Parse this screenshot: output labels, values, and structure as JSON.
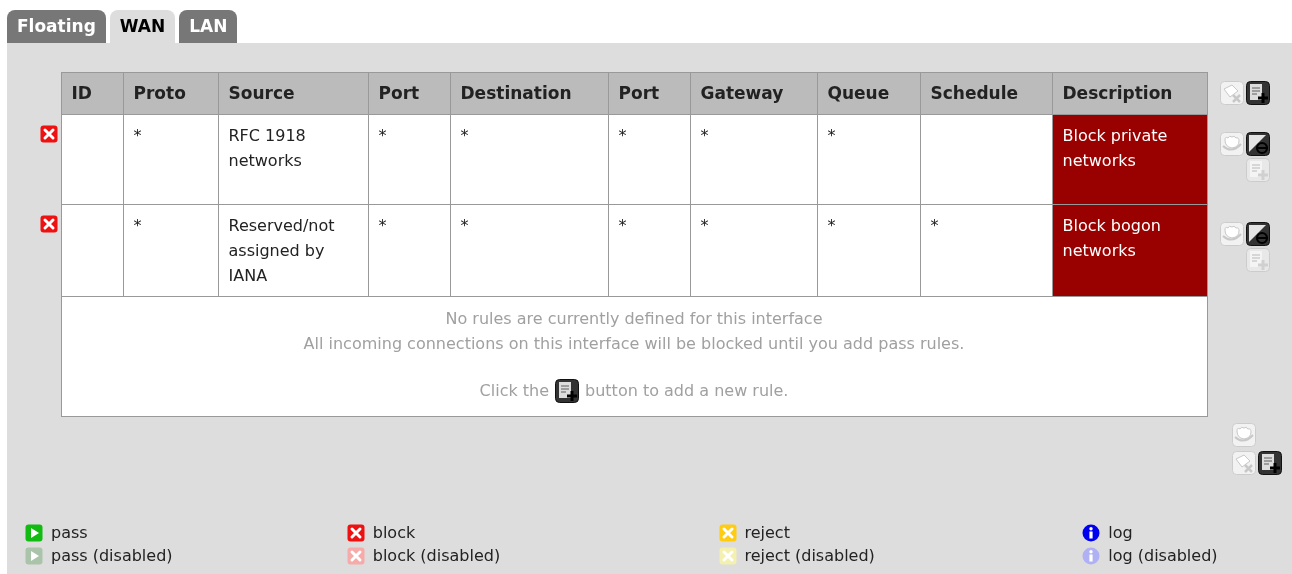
{
  "tabs": [
    {
      "label": "Floating",
      "selected": false
    },
    {
      "label": "WAN",
      "selected": true
    },
    {
      "label": "LAN",
      "selected": false
    }
  ],
  "table": {
    "columns": [
      "ID",
      "Proto",
      "Source",
      "Port",
      "Destination",
      "Port",
      "Gateway",
      "Queue",
      "Schedule",
      "Description"
    ],
    "rows": [
      {
        "kind": "block",
        "cells": [
          "",
          "*",
          "RFC 1918 networks",
          "*",
          "*",
          "*",
          "*",
          "*",
          "",
          "Block private networks"
        ]
      },
      {
        "kind": "block",
        "cells": [
          "",
          "*",
          "Reserved/not assigned by IANA",
          "*",
          "*",
          "*",
          "*",
          "*",
          "*",
          "Block bogon networks"
        ]
      }
    ],
    "empty_message": {
      "line_1": "No rules are currently defined for this interface",
      "line_2": "All incoming connections on this interface will be blocked until you add pass rules.",
      "hint_before": "Click the",
      "hint_after": "button to add a new rule."
    }
  },
  "legend": [
    {
      "kind": "pass",
      "label": "pass",
      "disabled": false
    },
    {
      "kind": "pass",
      "label": "pass (disabled)",
      "disabled": true
    },
    {
      "kind": "block",
      "label": "block",
      "disabled": false
    },
    {
      "kind": "block",
      "label": "block (disabled)",
      "disabled": true
    },
    {
      "kind": "reject",
      "label": "reject",
      "disabled": false
    },
    {
      "kind": "reject",
      "label": "reject (disabled)",
      "disabled": true
    },
    {
      "kind": "log",
      "label": "log",
      "disabled": false
    },
    {
      "kind": "log",
      "label": "log (disabled)",
      "disabled": true
    }
  ]
}
